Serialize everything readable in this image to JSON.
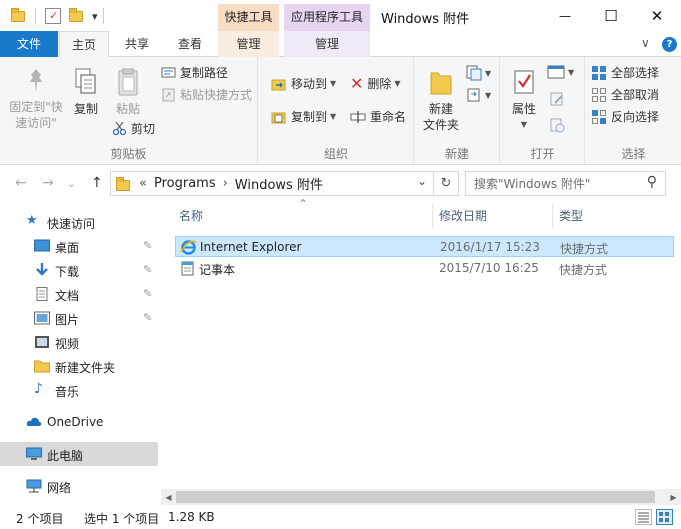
{
  "window": {
    "title": "Windows 附件",
    "minimize_glyph": "—",
    "maximize_glyph": "☐",
    "close_glyph": "✕"
  },
  "quick_access_toolbar": {
    "dropdown_glyph": "▾"
  },
  "context_tabs": {
    "shortcut_tools": "快捷工具",
    "app_tools": "应用程序工具"
  },
  "ribbon_tabs": {
    "file": "文件",
    "home": "主页",
    "share": "共享",
    "view": "查看",
    "manage1": "管理",
    "manage2": "管理",
    "expand_glyph": "∨",
    "help_glyph": "?"
  },
  "ribbon": {
    "clipboard": {
      "label": "剪贴板",
      "pin_line1": "固定到\"快",
      "pin_line2": "速访问\"",
      "copy": "复制",
      "paste": "粘贴",
      "copy_path": "复制路径",
      "paste_shortcut": "粘贴快捷方式",
      "cut": "剪切"
    },
    "organize": {
      "label": "组织",
      "move_to": "移动到",
      "copy_to": "复制到",
      "delete": "删除",
      "rename": "重命名"
    },
    "new": {
      "label": "新建",
      "new_folder_line1": "新建",
      "new_folder_line2": "文件夹"
    },
    "open": {
      "label": "打开",
      "properties": "属性"
    },
    "select": {
      "label": "选择",
      "select_all": "全部选择",
      "select_none": "全部取消",
      "invert": "反向选择"
    }
  },
  "address": {
    "back_glyph": "←",
    "forward_glyph": "→",
    "recent_glyph": "⌄",
    "up_glyph": "↑",
    "chevron": "«",
    "crumb1": "Programs",
    "sep": "›",
    "crumb2": "Windows 附件",
    "dropdown_glyph": "⌄",
    "refresh_glyph": "↻",
    "search_placeholder": "搜索\"Windows 附件\"",
    "search_glyph": "⚲"
  },
  "nav_pane": {
    "quick_access": "快速访问",
    "items": [
      {
        "label": "桌面",
        "pinned": true
      },
      {
        "label": "下载",
        "pinned": true
      },
      {
        "label": "文档",
        "pinned": true
      },
      {
        "label": "图片",
        "pinned": true
      },
      {
        "label": "视频",
        "pinned": false
      },
      {
        "label": "新建文件夹",
        "pinned": false
      },
      {
        "label": "音乐",
        "pinned": false
      }
    ],
    "onedrive": "OneDrive",
    "this_pc": "此电脑",
    "network": "网络",
    "pin_glyph": "📌"
  },
  "file_list": {
    "columns": {
      "name": "名称",
      "modified": "修改日期",
      "type": "类型"
    },
    "sort_glyph": "⌃",
    "rows": [
      {
        "name": "Internet Explorer",
        "modified": "2016/1/17 15:23",
        "type": "快捷方式",
        "selected": true
      },
      {
        "name": "记事本",
        "modified": "2015/7/10 16:25",
        "type": "快捷方式",
        "selected": false
      }
    ]
  },
  "scrollbar": {
    "left_glyph": "◀",
    "right_glyph": "▶"
  },
  "status_bar": {
    "item_count": "2 个项目",
    "selected": "选中 1 个项目",
    "size": "1.28 KB"
  }
}
